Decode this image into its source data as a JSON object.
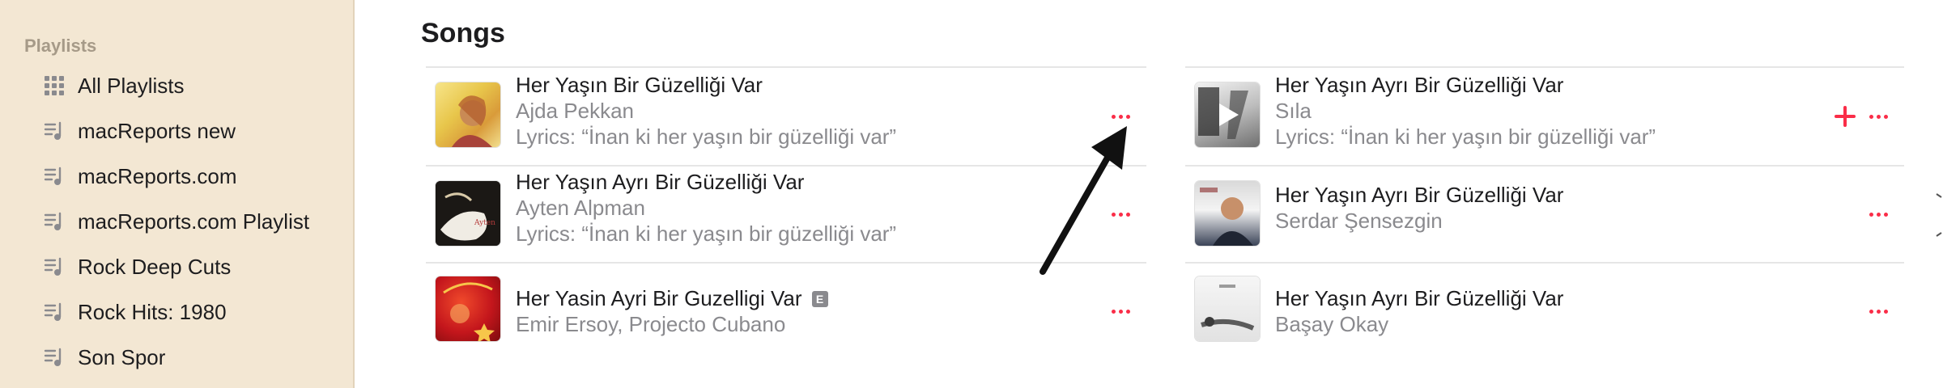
{
  "sidebar": {
    "section_title": "Playlists",
    "items": [
      {
        "label": "All Playlists",
        "icon": "grid-icon"
      },
      {
        "label": "macReports new",
        "icon": "playlist-icon"
      },
      {
        "label": "macReports.com",
        "icon": "playlist-icon"
      },
      {
        "label": "macReports.com Playlist",
        "icon": "playlist-icon"
      },
      {
        "label": "Rock Deep Cuts",
        "icon": "playlist-icon"
      },
      {
        "label": "Rock Hits: 1980",
        "icon": "playlist-icon"
      },
      {
        "label": "Son Spor",
        "icon": "playlist-icon"
      }
    ]
  },
  "main": {
    "title": "Songs",
    "songs_left": [
      {
        "title": "Her Yaşın Bir Güzelliği Var",
        "artist": "Ajda Pekkan",
        "lyrics": "Lyrics: “İnan ki her yaşın bir güzelliği var”"
      },
      {
        "title": "Her Yaşın Ayrı Bir Güzelliği Var",
        "artist": "Ayten Alpman",
        "lyrics": "Lyrics: “İnan ki her yaşın bir güzelliği var”"
      },
      {
        "title": "Her Yasin Ayri Bir Guzelligi Var",
        "artist": "Emir Ersoy, Projecto Cubano",
        "explicit": "E"
      }
    ],
    "songs_right": [
      {
        "title": "Her Yaşın Ayrı Bir Güzelliği Var",
        "artist": "Sıla",
        "lyrics": "Lyrics: “İnan ki her yaşın bir güzelliği var”"
      },
      {
        "title": "Her Yaşın Ayrı Bir Güzelliği Var",
        "artist": "Serdar Şensezgin"
      },
      {
        "title": "Her Yaşın Ayrı Bir Güzelliği Var",
        "artist": "Başay Okay"
      }
    ]
  },
  "colors": {
    "sidebar_bg": "#f3e7d3",
    "accent": "#fa2d48",
    "secondary_text": "#8a8a8e"
  }
}
